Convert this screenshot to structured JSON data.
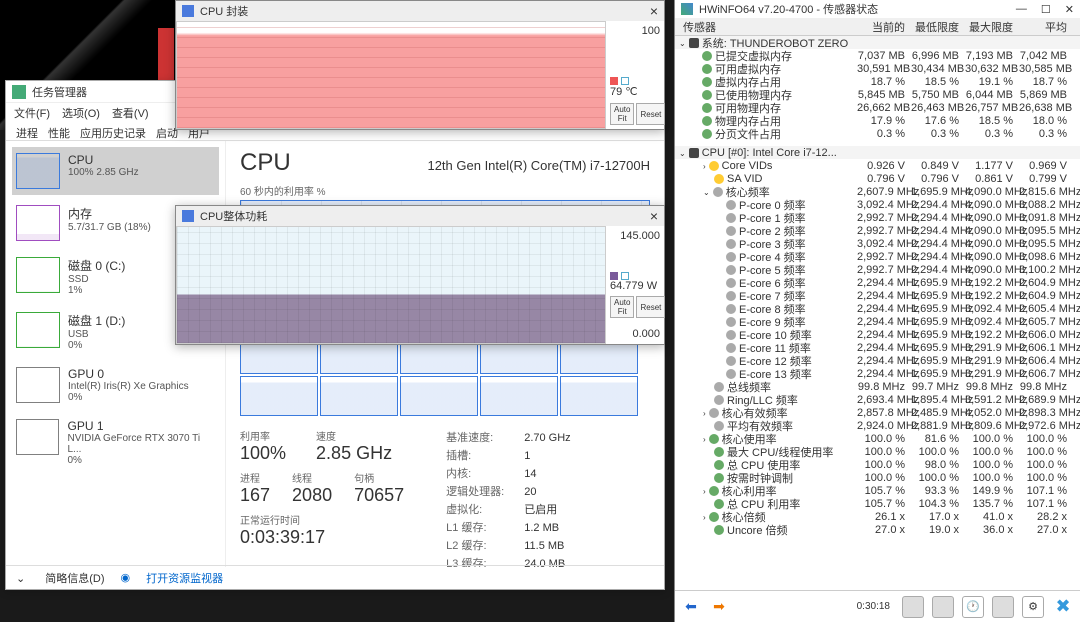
{
  "taskmgr": {
    "title": "任务管理器",
    "menu": [
      "文件(F)",
      "选项(O)",
      "查看(V)"
    ],
    "tabs": [
      "进程",
      "性能",
      "应用历史记录",
      "启动",
      "用户"
    ],
    "side": [
      {
        "name": "CPU",
        "sub": "100%  2.85 GHz"
      },
      {
        "name": "内存",
        "sub": "5.7/31.7 GB (18%)"
      },
      {
        "name": "磁盘 0 (C:)",
        "sub": "SSD",
        "sub2": "1%"
      },
      {
        "name": "磁盘 1 (D:)",
        "sub": "USB",
        "sub2": "0%"
      },
      {
        "name": "GPU 0",
        "sub": "Intel(R) Iris(R) Xe Graphics",
        "sub2": "0%"
      },
      {
        "name": "GPU 1",
        "sub": "NVIDIA GeForce RTX 3070 Ti L...",
        "sub2": "0%"
      }
    ],
    "main": {
      "title": "CPU",
      "model": "12th Gen Intel(R) Core(TM) i7-12700H",
      "chart_label": "60 秒内的利用率 %",
      "stats": {
        "util_l": "利用率",
        "util_v": "100%",
        "speed_l": "速度",
        "speed_v": "2.85 GHz",
        "proc_l": "进程",
        "proc_v": "167",
        "thr_l": "线程",
        "thr_v": "2080",
        "hnd_l": "句柄",
        "hnd_v": "70657",
        "up_l": "正常运行时间",
        "up_v": "0:03:39:17"
      },
      "specs": [
        [
          "基准速度:",
          "2.70 GHz"
        ],
        [
          "插槽:",
          "1"
        ],
        [
          "内核:",
          "14"
        ],
        [
          "逻辑处理器:",
          "20"
        ],
        [
          "虚拟化:",
          "已启用"
        ],
        [
          "L1 缓存:",
          "1.2 MB"
        ],
        [
          "L2 缓存:",
          "11.5 MB"
        ],
        [
          "L3 缓存:",
          "24.0 MB"
        ]
      ]
    },
    "foot": {
      "brief": "简略信息(D)",
      "mon": "打开资源监视器"
    }
  },
  "gw1": {
    "title": "CPU 封装",
    "max": "100",
    "val": "79 ℃",
    "autofit": "Auto Fit",
    "reset": "Reset"
  },
  "gw2": {
    "title": "CPU整体功耗",
    "max": "145.000",
    "mid": "64.779 W",
    "min": "0.000",
    "autofit": "Auto Fit",
    "reset": "Reset"
  },
  "hw": {
    "title": "HWiNFO64 v7.20-4700 - 传感器状态",
    "cols": [
      "传感器",
      "当前的",
      "最低限度",
      "最大限度",
      "平均"
    ],
    "sys_header": "系统: THUNDEROBOT ZERO",
    "sys_rows": [
      [
        "已提交虚拟内存",
        "7,037 MB",
        "6,996 MB",
        "7,193 MB",
        "7,042 MB"
      ],
      [
        "可用虚拟内存",
        "30,591 MB",
        "30,434 MB",
        "30,632 MB",
        "30,585 MB"
      ],
      [
        "虚拟内存占用",
        "18.7 %",
        "18.5 %",
        "19.1 %",
        "18.7 %"
      ],
      [
        "已使用物理内存",
        "5,845 MB",
        "5,750 MB",
        "6,044 MB",
        "5,869 MB"
      ],
      [
        "可用物理内存",
        "26,662 MB",
        "26,463 MB",
        "26,757 MB",
        "26,638 MB"
      ],
      [
        "物理内存占用",
        "17.9 %",
        "17.6 %",
        "18.5 %",
        "18.0 %"
      ],
      [
        "分页文件占用",
        "0.3 %",
        "0.3 %",
        "0.3 %",
        "0.3 %"
      ]
    ],
    "cpu_header": "CPU [#0]: Intel Core i7-12...",
    "cpu_rows": [
      [
        "Core VIDs",
        "0.926 V",
        "0.849 V",
        "1.177 V",
        "0.969 V",
        "y",
        2,
        "c"
      ],
      [
        "SA VID",
        "0.796 V",
        "0.796 V",
        "0.861 V",
        "0.799 V",
        "y",
        2,
        ""
      ],
      [
        "核心频率",
        "2,607.9 MHz",
        "1,695.9 MHz",
        "4,090.0 MHz",
        "2,815.6 MHz",
        "clock",
        2,
        "o"
      ],
      [
        "P-core 0 频率",
        "3,092.4 MHz",
        "2,294.4 MHz",
        "4,090.0 MHz",
        "3,088.2 MHz",
        "clock",
        3,
        ""
      ],
      [
        "P-core 1 频率",
        "2,992.7 MHz",
        "2,294.4 MHz",
        "4,090.0 MHz",
        "3,091.8 MHz",
        "clock",
        3,
        ""
      ],
      [
        "P-core 2 频率",
        "2,992.7 MHz",
        "2,294.4 MHz",
        "4,090.0 MHz",
        "3,095.5 MHz",
        "clock",
        3,
        ""
      ],
      [
        "P-core 3 频率",
        "3,092.4 MHz",
        "2,294.4 MHz",
        "4,090.0 MHz",
        "3,095.5 MHz",
        "clock",
        3,
        ""
      ],
      [
        "P-core 4 频率",
        "2,992.7 MHz",
        "2,294.4 MHz",
        "4,090.0 MHz",
        "3,098.6 MHz",
        "clock",
        3,
        ""
      ],
      [
        "P-core 5 频率",
        "2,992.7 MHz",
        "2,294.4 MHz",
        "4,090.0 MHz",
        "3,100.2 MHz",
        "clock",
        3,
        ""
      ],
      [
        "E-core 6 频率",
        "2,294.4 MHz",
        "1,695.9 MHz",
        "3,192.2 MHz",
        "2,604.9 MHz",
        "clock",
        3,
        ""
      ],
      [
        "E-core 7 频率",
        "2,294.4 MHz",
        "1,695.9 MHz",
        "3,192.2 MHz",
        "2,604.9 MHz",
        "clock",
        3,
        ""
      ],
      [
        "E-core 8 频率",
        "2,294.4 MHz",
        "1,695.9 MHz",
        "3,092.4 MHz",
        "2,605.4 MHz",
        "clock",
        3,
        ""
      ],
      [
        "E-core 9 频率",
        "2,294.4 MHz",
        "1,695.9 MHz",
        "3,092.4 MHz",
        "2,605.7 MHz",
        "clock",
        3,
        ""
      ],
      [
        "E-core 10 频率",
        "2,294.4 MHz",
        "1,695.9 MHz",
        "3,192.2 MHz",
        "2,606.0 MHz",
        "clock",
        3,
        ""
      ],
      [
        "E-core 11 频率",
        "2,294.4 MHz",
        "1,695.9 MHz",
        "3,291.9 MHz",
        "2,606.1 MHz",
        "clock",
        3,
        ""
      ],
      [
        "E-core 12 频率",
        "2,294.4 MHz",
        "1,695.9 MHz",
        "3,291.9 MHz",
        "2,606.4 MHz",
        "clock",
        3,
        ""
      ],
      [
        "E-core 13 频率",
        "2,294.4 MHz",
        "1,695.9 MHz",
        "3,291.9 MHz",
        "2,606.7 MHz",
        "clock",
        3,
        ""
      ],
      [
        "总线频率",
        "99.8 MHz",
        "99.7 MHz",
        "99.8 MHz",
        "99.8 MHz",
        "clock",
        2,
        ""
      ],
      [
        "Ring/LLC 频率",
        "2,693.4 MHz",
        "1,895.4 MHz",
        "3,591.2 MHz",
        "2,689.9 MHz",
        "clock",
        2,
        ""
      ],
      [
        "核心有效频率",
        "2,857.8 MHz",
        "2,485.9 MHz",
        "4,052.0 MHz",
        "2,898.3 MHz",
        "clock",
        2,
        "c"
      ],
      [
        "平均有效频率",
        "2,924.0 MHz",
        "2,881.9 MHz",
        "3,809.6 MHz",
        "2,972.6 MHz",
        "clock",
        2,
        ""
      ],
      [
        "核心使用率",
        "100.0 %",
        "81.6 %",
        "100.0 %",
        "100.0 %",
        "g",
        2,
        "c"
      ],
      [
        "最大 CPU/线程使用率",
        "100.0 %",
        "100.0 %",
        "100.0 %",
        "100.0 %",
        "g",
        2,
        ""
      ],
      [
        "总 CPU 使用率",
        "100.0 %",
        "98.0 %",
        "100.0 %",
        "100.0 %",
        "g",
        2,
        ""
      ],
      [
        "按需时钟调制",
        "100.0 %",
        "100.0 %",
        "100.0 %",
        "100.0 %",
        "g",
        2,
        ""
      ],
      [
        "核心利用率",
        "105.7 %",
        "93.3 %",
        "149.9 %",
        "107.1 %",
        "g",
        2,
        "c"
      ],
      [
        "总 CPU 利用率",
        "105.7 %",
        "104.3 %",
        "135.7 %",
        "107.1 %",
        "g",
        2,
        ""
      ],
      [
        "核心倍频",
        "26.1 x",
        "17.0 x",
        "41.0 x",
        "28.2 x",
        "g",
        2,
        "c"
      ],
      [
        "Uncore 倍频",
        "27.0 x",
        "19.0 x",
        "36.0 x",
        "27.0 x",
        "g",
        2,
        ""
      ]
    ],
    "foot_time": "0:30:18"
  }
}
